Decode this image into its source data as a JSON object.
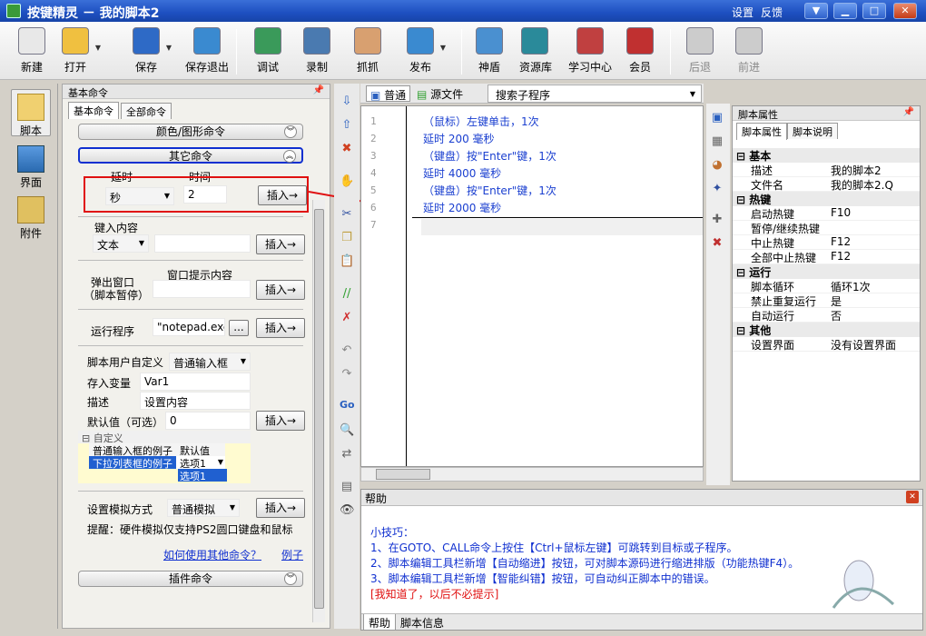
{
  "window": {
    "title": "按键精灵 － 我的脚本2",
    "links": [
      "设置",
      "反馈"
    ]
  },
  "toolbar": [
    {
      "label": "新建",
      "icon": "new-file-icon",
      "color": "#e8e8e8",
      "arrow": false
    },
    {
      "label": "打开",
      "icon": "folder-open-icon",
      "color": "#f0c040",
      "arrow": true
    },
    {
      "label": "保存",
      "icon": "save-icon",
      "color": "#2e6ac6",
      "arrow": true
    },
    {
      "label": "保存退出",
      "icon": "save-exit-icon",
      "color": "#3a8ad0",
      "arrow": false
    },
    {
      "label": "调试",
      "icon": "debug-icon",
      "color": "#3a9a5a",
      "arrow": false
    },
    {
      "label": "录制",
      "icon": "record-camera-icon",
      "color": "#4a7ab0",
      "arrow": false
    },
    {
      "label": "抓抓",
      "icon": "grab-hand-icon",
      "color": "#d8a070",
      "arrow": false
    },
    {
      "label": "发布",
      "icon": "publish-globe-icon",
      "color": "#3a8ad0",
      "arrow": true
    },
    {
      "label": "神盾",
      "icon": "shield-icon",
      "color": "#4a90d0",
      "arrow": false
    },
    {
      "label": "资源库",
      "icon": "resource-library-icon",
      "color": "#2a8a9a",
      "arrow": false
    },
    {
      "label": "学习中心",
      "icon": "learning-center-icon",
      "color": "#c04040",
      "arrow": false
    },
    {
      "label": "会员",
      "icon": "member-icon",
      "color": "#c03030",
      "arrow": false
    },
    {
      "label": "后退",
      "icon": "back-arrow-icon",
      "color": "#cccccc",
      "arrow": false
    },
    {
      "label": "前进",
      "icon": "forward-arrow-icon",
      "color": "#cccccc",
      "arrow": false
    }
  ],
  "nav": [
    {
      "label": "脚本",
      "icon": "script-icon",
      "color": "#f0d070"
    },
    {
      "label": "界面",
      "icon": "interface-icon",
      "color": "#3a7ac0"
    },
    {
      "label": "附件",
      "icon": "attachment-icon",
      "color": "#e0c060"
    }
  ],
  "cmd": {
    "header": "基本命令",
    "tabs": [
      "基本命令",
      "全部命令"
    ],
    "group_image": "颜色/图形命令",
    "group_other": "其它命令",
    "group_plugin": "插件命令",
    "delay_label": "延时",
    "time_label": "时间",
    "unit": "秒",
    "delay_value": "2",
    "insert": "插入→",
    "keyin_label": "键入内容",
    "text_type": "文本",
    "popup_label_1": "弹出窗口",
    "popup_label_2": "（脚本暂停）",
    "popup_content_label": "窗口提示内容",
    "run_label": "运行程序",
    "run_value": "\"notepad.exe\"",
    "browse": "...",
    "user_def_label": "脚本用户自定义",
    "user_def_type": "普通输入框",
    "var_label": "存入变量",
    "var_value": "Var1",
    "desc_label": "描述",
    "desc_value": "设置内容",
    "default_label": "默认值（可选）",
    "default_value": "0",
    "custom_header": "自定义",
    "custom_row1_k": "普通输入框的例子",
    "custom_row1_v": "默认值",
    "custom_row2_k": "下拉列表框的例子",
    "custom_row2_v": "选项1",
    "custom_dropdown": "选项1",
    "sim_label": "设置模拟方式",
    "sim_type": "普通模拟",
    "sim_tip": "提醒：硬件模拟仅支持PS2圆口键盘和鼠标",
    "help_link": "如何使用其他命令？",
    "example_link": "例子"
  },
  "editor": {
    "tab_normal": "普通",
    "tab_source": "源文件",
    "search_placeholder": "搜索子程序",
    "lines": [
      "（鼠标）左键单击，1次",
      "延时 200 毫秒",
      "（键盘）按\"Enter\"键，1次",
      "延时 4000 毫秒",
      "（键盘）按\"Enter\"键，1次",
      "延时 2000 毫秒",
      ""
    ]
  },
  "props": {
    "header": "脚本属性",
    "tabs": [
      "脚本属性",
      "脚本说明"
    ],
    "sections": [
      {
        "name": "基本",
        "rows": [
          [
            "描述",
            "我的脚本2"
          ],
          [
            "文件名",
            "我的脚本2.Q"
          ]
        ]
      },
      {
        "name": "热键",
        "rows": [
          [
            "启动热键",
            "F10"
          ],
          [
            "暂停/继续热键",
            ""
          ],
          [
            "中止热键",
            "F12"
          ],
          [
            "全部中止热键",
            "F12"
          ]
        ]
      },
      {
        "name": "运行",
        "rows": [
          [
            "脚本循环",
            "循环1次"
          ],
          [
            "禁止重复运行",
            "是"
          ],
          [
            "自动运行",
            "否"
          ]
        ]
      },
      {
        "name": "其他",
        "rows": [
          [
            "设置界面",
            "没有设置界面"
          ]
        ]
      }
    ]
  },
  "help": {
    "title": "帮助",
    "tip_title": "小技巧：",
    "lines": [
      "1、在GOTO、CALL命令上按住【Ctrl+鼠标左键】可跳转到目标或子程序。",
      "2、脚本编辑工具栏新增【自动缩进】按钮，可对脚本源码进行缩进排版（功能热键F4）。",
      "3、脚本编辑工具栏新增【智能纠错】按钮，可自动纠正脚本中的错误。"
    ],
    "dismiss": "[我知道了，以后不必提示]",
    "tabs": [
      "帮助",
      "脚本信息"
    ]
  }
}
